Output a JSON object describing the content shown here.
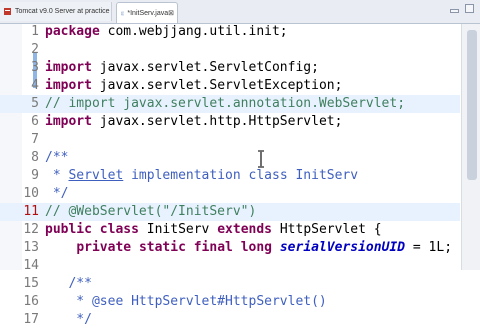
{
  "tabs": [
    {
      "label": "Tomcat v9.0 Server at practice",
      "icon": "server-icon"
    },
    {
      "label": "*InitServ.java",
      "icon": "java-file-icon",
      "close": "⊠"
    }
  ],
  "colors": {
    "keyword": "#7f0055",
    "comment": "#3f7f5f",
    "javadoc": "#3f5fbf",
    "string": "#2a00ff",
    "field": "#0000c0",
    "current_line": "#e8f2fe"
  },
  "lines": [
    {
      "n": "1",
      "tokens": [
        [
          "kw",
          "package"
        ],
        [
          "",
          "com.webjjang.util.init;"
        ]
      ]
    },
    {
      "n": "2",
      "tokens": []
    },
    {
      "n": "3",
      "tokens": [
        [
          "kw",
          "import"
        ],
        [
          "",
          "javax.servlet.ServletConfig;"
        ]
      ]
    },
    {
      "n": "4",
      "tokens": [
        [
          "kw",
          "import"
        ],
        [
          "",
          "javax.servlet.ServletException;"
        ]
      ]
    },
    {
      "n": "5",
      "tokens": [
        [
          "com",
          "// import javax.servlet.annotation.WebServlet;"
        ]
      ]
    },
    {
      "n": "6",
      "tokens": [
        [
          "kw",
          "import"
        ],
        [
          "",
          "javax.servlet.http.HttpServlet;"
        ]
      ]
    },
    {
      "n": "7",
      "tokens": []
    },
    {
      "n": "8",
      "tokens": [
        [
          "jd",
          "/**"
        ]
      ]
    },
    {
      "n": "9",
      "tokens": [
        [
          "jd",
          " * "
        ],
        [
          "jd und",
          "Servlet"
        ],
        [
          "jd",
          " implementation class InitServ"
        ]
      ]
    },
    {
      "n": "10",
      "tokens": [
        [
          "jd",
          " */"
        ]
      ]
    },
    {
      "n": "11",
      "tokens": [
        [
          "com",
          "// @WebServlet(\"/InitServ\")"
        ]
      ]
    },
    {
      "n": "12",
      "tokens": [
        [
          "kw",
          "public"
        ],
        [
          "",
          " "
        ],
        [
          "kw",
          "class"
        ],
        [
          "",
          " InitServ "
        ],
        [
          "kw",
          "extends"
        ],
        [
          "",
          " HttpServlet {"
        ]
      ]
    },
    {
      "n": "13",
      "tokens": [
        [
          "",
          " "
        ],
        [
          "kw",
          "private"
        ],
        [
          "",
          " "
        ],
        [
          "kw",
          "static"
        ],
        [
          "",
          " "
        ],
        [
          "kw",
          "final"
        ],
        [
          "",
          " "
        ],
        [
          "kw",
          "long"
        ],
        [
          "",
          " "
        ],
        [
          "fld",
          "serialVersionUID"
        ],
        [
          "",
          " = 1L;"
        ]
      ]
    },
    {
      "n": "14",
      "tokens": []
    },
    {
      "n": "15",
      "tokens": [
        [
          "jd",
          "   /**"
        ]
      ]
    },
    {
      "n": "16",
      "tokens": [
        [
          "jd",
          "    * @see HttpServlet#HttpServlet()"
        ]
      ]
    },
    {
      "n": "17",
      "tokens": [
        [
          "jd",
          "    */"
        ]
      ]
    }
  ]
}
